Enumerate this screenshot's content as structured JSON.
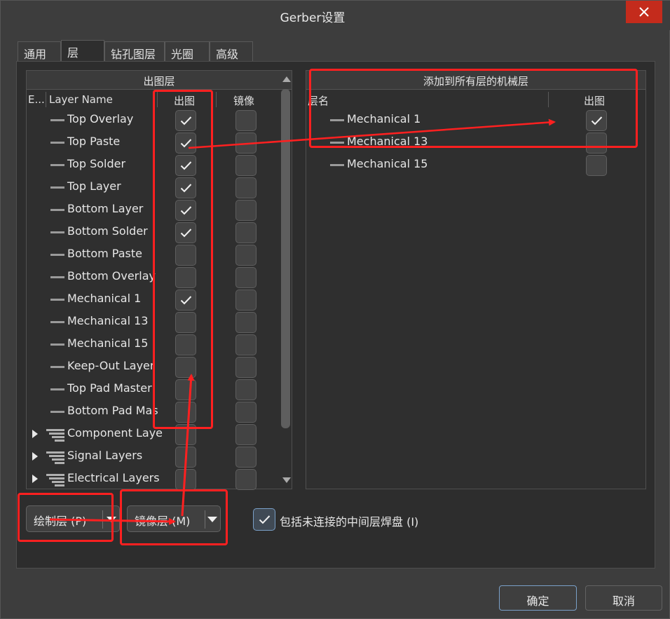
{
  "window": {
    "title": "Gerber设置",
    "close_label": "close"
  },
  "tabs": [
    {
      "label": "通用",
      "active": false
    },
    {
      "label": "层",
      "active": true
    },
    {
      "label": "钻孔图层",
      "active": false
    },
    {
      "label": "光圈",
      "active": false
    },
    {
      "label": "高级",
      "active": false
    }
  ],
  "left_panel": {
    "header": "出图层",
    "columns": {
      "e": "E...",
      "layer_name": "Layer Name",
      "plot": "出图",
      "mirror": "镜像"
    },
    "rows": [
      {
        "label": "Top Overlay",
        "plot": true,
        "mirror": false,
        "group": false
      },
      {
        "label": "Top Paste",
        "plot": true,
        "mirror": false,
        "group": false
      },
      {
        "label": "Top Solder",
        "plot": true,
        "mirror": false,
        "group": false
      },
      {
        "label": "Top Layer",
        "plot": true,
        "mirror": false,
        "group": false
      },
      {
        "label": "Bottom Layer",
        "plot": true,
        "mirror": false,
        "group": false
      },
      {
        "label": "Bottom Solder",
        "plot": true,
        "mirror": false,
        "group": false
      },
      {
        "label": "Bottom Paste",
        "plot": false,
        "mirror": false,
        "group": false
      },
      {
        "label": "Bottom Overlay",
        "plot": false,
        "mirror": false,
        "group": false
      },
      {
        "label": "Mechanical 1",
        "plot": true,
        "mirror": false,
        "group": false
      },
      {
        "label": "Mechanical 13",
        "plot": false,
        "mirror": false,
        "group": false
      },
      {
        "label": "Mechanical 15",
        "plot": false,
        "mirror": false,
        "group": false
      },
      {
        "label": "Keep-Out Layer",
        "plot": false,
        "mirror": false,
        "group": false
      },
      {
        "label": "Top Pad Master",
        "plot": false,
        "mirror": false,
        "group": false
      },
      {
        "label": "Bottom Pad Mas",
        "plot": false,
        "mirror": false,
        "group": false
      },
      {
        "label": "Component Laye",
        "plot": false,
        "mirror": false,
        "group": true
      },
      {
        "label": "Signal Layers",
        "plot": false,
        "mirror": false,
        "group": true
      },
      {
        "label": "Electrical Layers",
        "plot": false,
        "mirror": false,
        "group": true
      }
    ]
  },
  "right_panel": {
    "header": "添加到所有层的机械层",
    "columns": {
      "layer_name": "层名",
      "plot": "出图"
    },
    "rows": [
      {
        "label": "Mechanical 1",
        "plot": true
      },
      {
        "label": "Mechanical 13",
        "plot": false
      },
      {
        "label": "Mechanical 15",
        "plot": false
      }
    ]
  },
  "bottom": {
    "plot_layers_button": "绘制层 (P)",
    "mirror_layers_button": "镜像层 (M)",
    "include_unconnected_label": "包括未连接的中间层焊盘 (I)",
    "include_unconnected_checked": true
  },
  "footer": {
    "ok_label": "确定",
    "cancel_label": "取消"
  },
  "colors": {
    "annotation": "#ff2020",
    "close_bg": "#c42b1c",
    "focus_border": "#7aa0c8"
  }
}
